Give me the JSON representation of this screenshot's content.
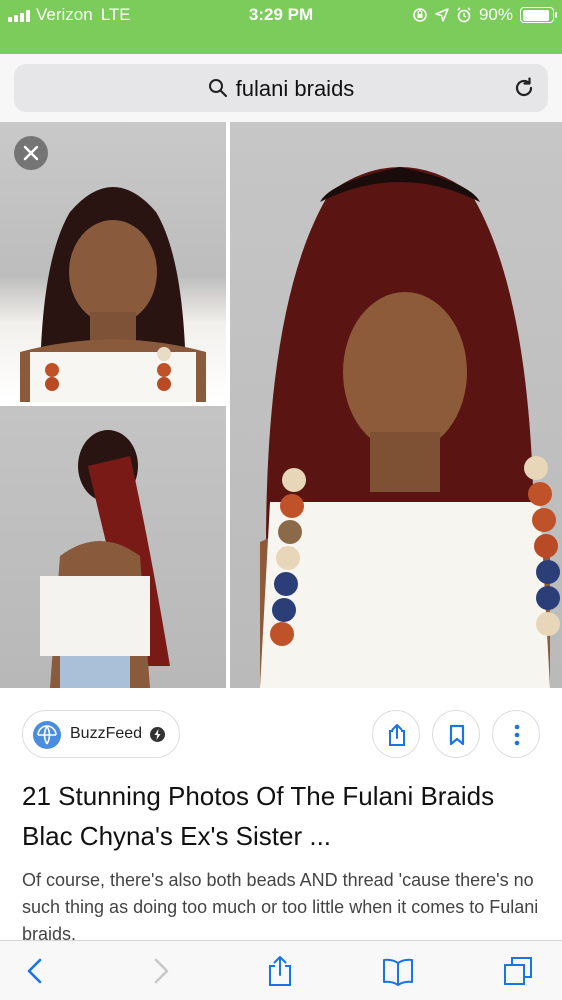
{
  "status_bar": {
    "carrier": "Verizon",
    "network": "LTE",
    "time": "3:29 PM",
    "battery": "90%",
    "battery_level": 0.9,
    "icons": [
      "signal-bars-icon",
      "lock-rotation-icon",
      "location-arrow-icon",
      "alarm-icon",
      "battery-icon"
    ]
  },
  "address_bar": {
    "query": "fulani braids",
    "icons": [
      "search-icon",
      "reload-icon"
    ]
  },
  "result": {
    "source": "BuzzFeed",
    "title": "21 Stunning Photos Of The Fulani Braids Blac Chyna's Ex's Sister ...",
    "snippet": "Of course, there's also both beads AND thread 'cause there's no such thing as doing too much or too little when it comes to Fulani braids."
  },
  "toolbar": {
    "icons": [
      "back-icon",
      "forward-icon",
      "share-icon",
      "bookmarks-icon",
      "tabs-icon"
    ]
  },
  "colors": {
    "status_bar": "#7ccc5b",
    "accent": "#1a73e8",
    "text": "#111111",
    "snippet": "#444444"
  }
}
